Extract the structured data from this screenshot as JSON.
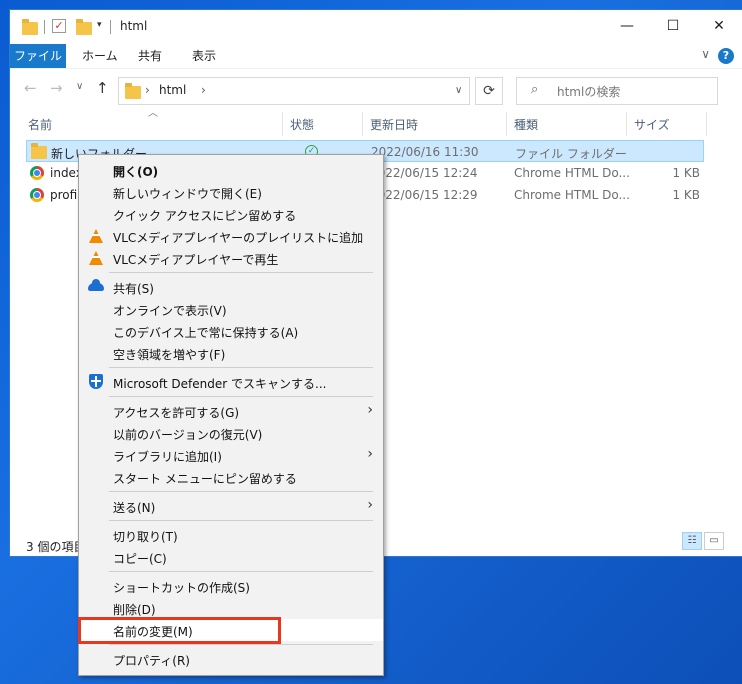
{
  "window": {
    "title": "html",
    "controls": {
      "minimize": "—",
      "maximize": "☐",
      "close": "✕"
    }
  },
  "ribbon": {
    "tabs": [
      "ファイル",
      "ホーム",
      "共有",
      "表示"
    ],
    "help": "?"
  },
  "address": {
    "path": "html",
    "search_placeholder": "htmlの検索"
  },
  "columns": {
    "name": "名前",
    "status": "状態",
    "date": "更新日時",
    "type": "種類",
    "size": "サイズ"
  },
  "files": [
    {
      "name": "新しいフォルダー",
      "date": "2022/06/16 11:30",
      "type": "ファイル フォルダー",
      "size": "",
      "icon": "folder-icon"
    },
    {
      "name": "index",
      "date": "2022/06/15 12:24",
      "type": "Chrome HTML Do...",
      "size": "1 KB",
      "icon": "chrome-icon"
    },
    {
      "name": "profil",
      "date": "2022/06/15 12:29",
      "type": "Chrome HTML Do...",
      "size": "1 KB",
      "icon": "chrome-icon"
    }
  ],
  "status_bar": {
    "item_count": "3 個の項目"
  },
  "context_menu": {
    "open": "開く(O)",
    "open_new_window": "新しいウィンドウで開く(E)",
    "pin_quick_access": "クイック アクセスにピン留めする",
    "vlc_add_playlist": "VLCメディアプレイヤーのプレイリストに追加",
    "vlc_play": "VLCメディアプレイヤーで再生",
    "share": "共有(S)",
    "view_online": "オンラインで表示(V)",
    "always_keep": "このデバイス上で常に保持する(A)",
    "free_space": "空き領域を増やす(F)",
    "defender_scan": "Microsoft Defender でスキャンする...",
    "give_access": "アクセスを許可する(G)",
    "restore_versions": "以前のバージョンの復元(V)",
    "add_to_library": "ライブラリに追加(I)",
    "pin_start": "スタート メニューにピン留めする",
    "send_to": "送る(N)",
    "cut": "切り取り(T)",
    "copy": "コピー(C)",
    "create_shortcut": "ショートカットの作成(S)",
    "delete": "削除(D)",
    "rename": "名前の変更(M)",
    "properties": "プロパティ(R)"
  },
  "colors": {
    "accent": "#1979ca",
    "selection": "#cce8ff",
    "highlight_box": "#e8361f",
    "desktop": "#0a5bd0"
  }
}
